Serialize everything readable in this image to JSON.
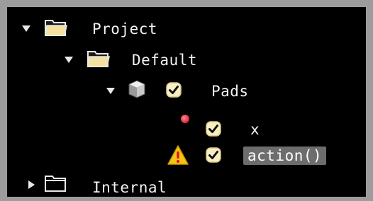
{
  "tree": {
    "items": [
      {
        "label": "Project",
        "expanded": true,
        "icon": "folder-open-icon"
      },
      {
        "label": "Default",
        "expanded": true,
        "icon": "folder-open-icon"
      },
      {
        "label": "Pads",
        "expanded": true,
        "icon": "cube-icon",
        "checked": true
      },
      {
        "label": "x",
        "icon": "red-dot-icon",
        "checked": true
      },
      {
        "label": "action()",
        "icon": "warning-icon",
        "checked": true,
        "selected": true
      },
      {
        "label": "Internal",
        "expanded": false,
        "icon": "folder-closed-icon"
      }
    ]
  },
  "colors": {
    "background": "#000000",
    "frame": "#9c9c9c",
    "folder_fill": "#f4e1a0",
    "checkbox_fill": "#f7efc2",
    "checkbox_check": "#111111",
    "warning_fill": "#f6c419",
    "warning_mark": "#e01010",
    "dot": "#e5334a",
    "selection_bg": "#6d6d6d",
    "text": "#f2f2f2"
  }
}
